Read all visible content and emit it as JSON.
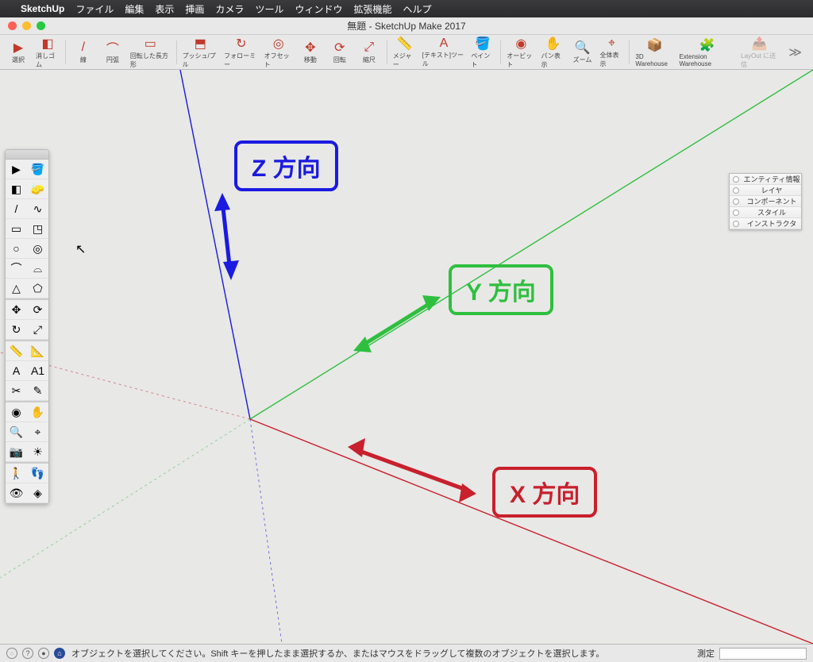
{
  "mac_menu": {
    "app": "SketchUp",
    "items": [
      "ファイル",
      "編集",
      "表示",
      "挿画",
      "カメラ",
      "ツール",
      "ウィンドウ",
      "拡張機能",
      "ヘルプ"
    ]
  },
  "window_title": "無題 - SketchUp Make 2017",
  "toolbar": [
    {
      "label": "選択",
      "icon": "▶"
    },
    {
      "label": "消しゴム",
      "icon": "◧"
    },
    {
      "label": "線",
      "icon": "/"
    },
    {
      "label": "円弧",
      "icon": "⌒"
    },
    {
      "label": "回転した長方形",
      "icon": "▭"
    },
    {
      "label": "プッシュ/プル",
      "icon": "⬒"
    },
    {
      "label": "フォローミー",
      "icon": "↻"
    },
    {
      "label": "オフセット",
      "icon": "◎"
    },
    {
      "label": "移動",
      "icon": "✥"
    },
    {
      "label": "回転",
      "icon": "⟳"
    },
    {
      "label": "縮尺",
      "icon": "⤢"
    },
    {
      "label": "メジャー",
      "icon": "📏"
    },
    {
      "label": "[テキスト]ツール",
      "icon": "A"
    },
    {
      "label": "ペイント",
      "icon": "🪣"
    },
    {
      "label": "オービット",
      "icon": "◉"
    },
    {
      "label": "パン表示",
      "icon": "✋"
    },
    {
      "label": "ズーム",
      "icon": "🔍"
    },
    {
      "label": "全体表示",
      "icon": "⌖"
    },
    {
      "label": "3D Warehouse",
      "icon": "📦"
    },
    {
      "label": "Extension Warehouse",
      "icon": "🧩"
    },
    {
      "label": "LayOut に送信",
      "icon": "📤",
      "disabled": true
    }
  ],
  "axis_labels": {
    "x": "X 方向",
    "y": "Y 方向",
    "z": "Z 方向"
  },
  "info_panel": [
    "エンティティ情報",
    "レイヤ",
    "コンポーネント",
    "スタイル",
    "インストラクタ"
  ],
  "status": {
    "hint": "オブジェクトを選択してください。Shift キーを押したまま選択するか、またはマウスをドラッグして複数のオブジェクトを選択します。",
    "right_label": "測定"
  },
  "colors": {
    "x": "#c8202d",
    "y": "#2fbf3f",
    "z": "#1a1ae0"
  }
}
